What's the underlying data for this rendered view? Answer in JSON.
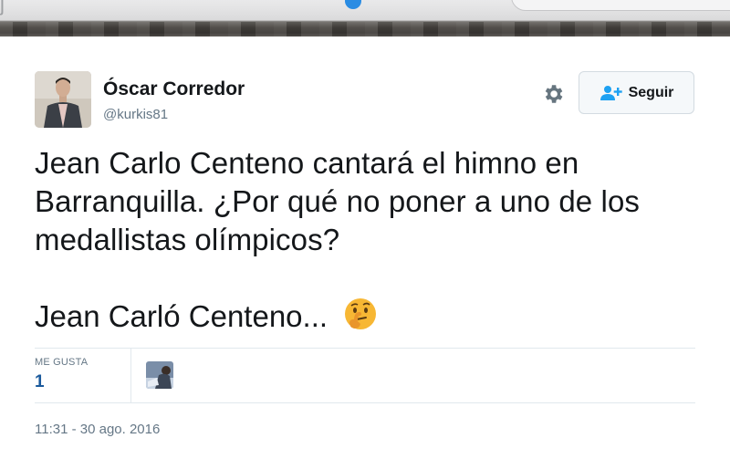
{
  "tweet": {
    "author_name": "Óscar Corredor",
    "author_handle": "@kurkis81",
    "follow_label": "Seguir",
    "text": "Jean Carlo Centeno cantará el himno en Barranquilla. ¿Por qué no poner a uno de los medallistas olímpicos?",
    "text_line2": "Jean Carló Centeno...",
    "emoji_icon": "thinking-face-emoji",
    "likes_label": "ME GUSTA",
    "likes_count": "1",
    "timestamp": "11:31 - 30 ago. 2016"
  },
  "colors": {
    "text": "#14171a",
    "muted": "#657786",
    "likes": "#1b5a9c",
    "divider": "#e1e8ed",
    "button_bg": "#f5f8fa",
    "follow_icon": "#1da1f2"
  },
  "icons": {
    "settings": "gear-icon",
    "follow": "add-user-icon"
  }
}
